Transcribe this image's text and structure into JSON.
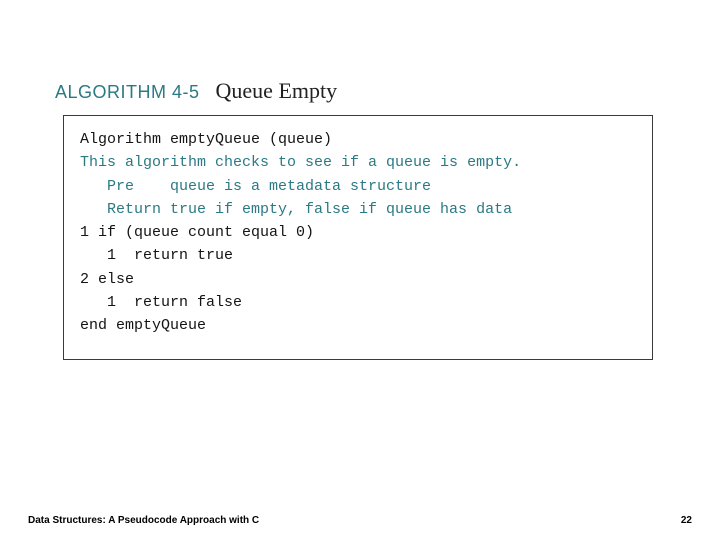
{
  "heading": {
    "label": "ALGORITHM 4-5",
    "title": "Queue Empty"
  },
  "code": {
    "lines": [
      "Algorithm emptyQueue (queue)",
      "This algorithm checks to see if a queue is empty.",
      "   Pre    queue is a metadata structure",
      "   Return true if empty, false if queue has data",
      "1 if (queue count equal 0)",
      "   1  return true",
      "2 else",
      "   1  return false",
      "end emptyQueue"
    ]
  },
  "footer": {
    "text": "Data Structures: A Pseudocode Approach with C",
    "page": "22"
  }
}
